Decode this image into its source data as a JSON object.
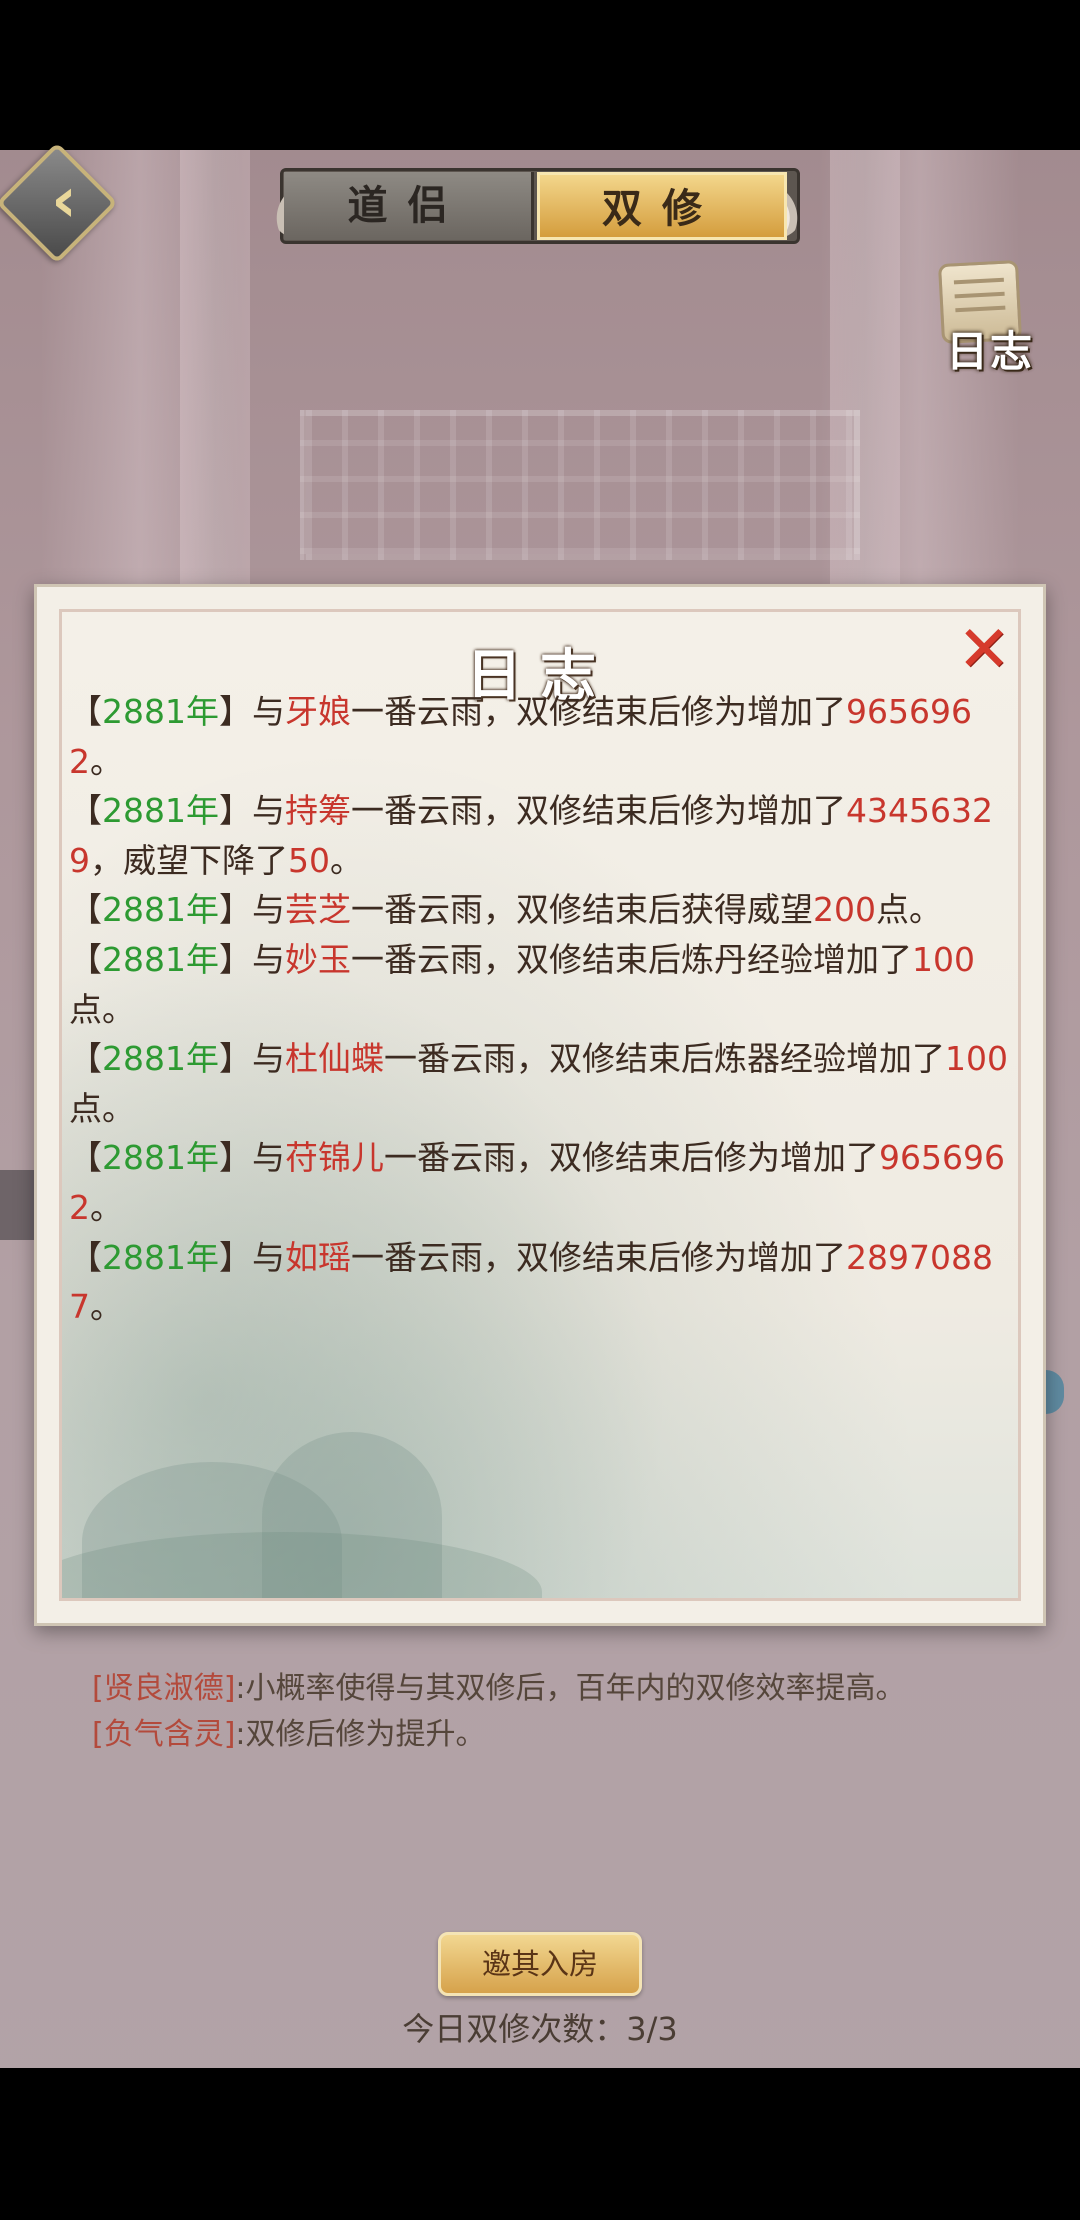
{
  "header": {
    "tabs": [
      {
        "label": "道侣",
        "active": false
      },
      {
        "label": "双修",
        "active": true
      }
    ],
    "log_button_label": "日志"
  },
  "log_dialog": {
    "title": "日志",
    "entries": [
      {
        "year": "2881年",
        "prefix": "【",
        "mid": "】与",
        "name": "牙娘",
        "text": "一番云雨，双修结束后修为增加了",
        "value": "9656962",
        "tail": "。",
        "extra_text": "",
        "extra_value": "",
        "extra_tail": ""
      },
      {
        "year": "2881年",
        "prefix": "【",
        "mid": "】与",
        "name": "持筹",
        "text": "一番云雨，双修结束后修为增加了",
        "value": "43456329",
        "tail": "",
        "extra_text": "，威望下降了",
        "extra_value": "50",
        "extra_tail": "。"
      },
      {
        "year": "2881年",
        "prefix": "【",
        "mid": "】与",
        "name": "芸芝",
        "text": "一番云雨，双修结束后获得威望",
        "value": "200",
        "tail": "点。",
        "extra_text": "",
        "extra_value": "",
        "extra_tail": ""
      },
      {
        "year": "2881年",
        "prefix": "【",
        "mid": "】与",
        "name": "妙玉",
        "text": "一番云雨，双修结束后炼丹经验增加了",
        "value": "100",
        "tail": "点。",
        "extra_text": "",
        "extra_value": "",
        "extra_tail": ""
      },
      {
        "year": "2881年",
        "prefix": "【",
        "mid": "】与",
        "name": "杜仙蝶",
        "text": "一番云雨，双修结束后炼器经验增加了",
        "value": "100",
        "tail": "点。",
        "extra_text": "",
        "extra_value": "",
        "extra_tail": ""
      },
      {
        "year": "2881年",
        "prefix": "【",
        "mid": "】与",
        "name": "苻锦儿",
        "text": "一番云雨，双修结束后修为增加了",
        "value": "9656962",
        "tail": "。",
        "extra_text": "",
        "extra_value": "",
        "extra_tail": ""
      },
      {
        "year": "2881年",
        "prefix": "【",
        "mid": "】与",
        "name": "如瑶",
        "text": "一番云雨，双修结束后修为增加了",
        "value": "28970887",
        "tail": "。",
        "extra_text": "",
        "extra_value": "",
        "extra_tail": ""
      }
    ]
  },
  "traits": [
    {
      "name": "[贤良淑德]",
      "desc": ":小概率使得与其双修后，百年内的双修效率提高。"
    },
    {
      "name": "[负气含灵]",
      "desc": ":双修后修为提升。"
    }
  ],
  "invite_button_label": "邀其入房",
  "daily_count": {
    "label": "今日双修次数：",
    "value": "3/3"
  },
  "colors": {
    "year": "#2d9a32",
    "highlight": "#c8362d",
    "active_tab": "#e8bf66"
  }
}
